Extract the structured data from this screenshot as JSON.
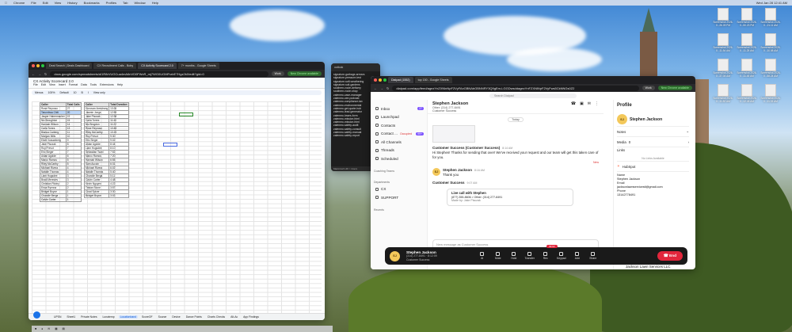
{
  "menubar": {
    "items": [
      "Chrome",
      "File",
      "Edit",
      "View",
      "History",
      "Bookmarks",
      "Profiles",
      "Tab",
      "Window",
      "Help"
    ],
    "clock": "Wed Jan 28 12:41 AM"
  },
  "sheets_window": {
    "tabs": [
      "Deal Search | Deals Dashboard",
      "CX Recruitment Calls - Boby",
      "CX Activity Scorecard 2.0",
      "7+ months - Google Sheets"
    ],
    "url": "docs.google.com/spreadsheets/d/1R8rVUGCua4mA6nVD0FWcR_mj7WG0UGMFrzbE7Hgz2k0/edit?gid=0",
    "work_label": "Work",
    "new_chrome": "New Chrome available",
    "doc_title": "CX Activity Scorecard 2.0",
    "menu": [
      "File",
      "Edit",
      "View",
      "Insert",
      "Format",
      "Data",
      "Tools",
      "Extensions",
      "Help"
    ],
    "toolbar": [
      "Menus",
      "100%",
      "Default",
      "10",
      "B",
      "I",
      "View only"
    ],
    "table1_headers": [
      "Caller",
      "Total Calls"
    ],
    "table1_rows": [
      [
        "Rose Reynoso",
        "27"
      ],
      [
        "Tarumbwa Chiti",
        "20"
      ],
      [
        "Jasper Habermacher",
        "19"
      ],
      [
        "Nic Broughton",
        "15"
      ],
      [
        "Hannah Wilson",
        "14"
      ],
      [
        "Carla Torres",
        "13"
      ],
      [
        "Bianca Carberg",
        "11"
      ],
      [
        "Morgan Mills",
        "10"
      ],
      [
        "Eliott Vossanberg",
        "9"
      ],
      [
        "Jake Pisczak",
        "8"
      ],
      [
        "Roy Prevot",
        "7"
      ],
      [
        "Eric Sleger",
        "7"
      ],
      [
        "Aidan Agolde",
        "6"
      ],
      [
        "Marco Ramos",
        "5"
      ],
      [
        "Riley McCarthy",
        "5"
      ],
      [
        "Michael Rivera",
        "4"
      ],
      [
        "Natalie Thomas",
        "4"
      ],
      [
        "Liam Hogsdee",
        "3"
      ],
      [
        "Bradi Meresiev",
        "3"
      ],
      [
        "Christian Fitzley",
        "2"
      ],
      [
        "Erica Ryenna",
        "2"
      ],
      [
        "Bridget Boyce",
        "1"
      ],
      [
        "Chandie Berga",
        "1"
      ],
      [
        "Calvin Carter",
        "1"
      ]
    ],
    "table2_headers": [
      "Caller",
      "Total Duration"
    ],
    "table2_rows": [
      [
        "Donovan Armstrong",
        "13:26"
      ],
      [
        "Jasmin Jongs",
        "12:55"
      ],
      [
        "Jake Pisczak",
        "12:38"
      ],
      [
        "Carla Torres",
        "11:40"
      ],
      [
        "Nic Brogdon",
        "11:22"
      ],
      [
        "Rose Reynoso",
        "10:48"
      ],
      [
        "Riley McCarthy",
        "10:15"
      ],
      [
        "Roy Prevot",
        "9:30"
      ],
      [
        "Eric Sleger",
        "9:02"
      ],
      [
        "Aidan Agolde",
        "8:44"
      ],
      [
        "Liam Hogsdee",
        "8:10"
      ],
      [
        "Sebastian Tsani",
        "7:52"
      ],
      [
        "Marco Ramos",
        "7:20"
      ],
      [
        "Hannah Wilson",
        "6:55"
      ],
      [
        "Sam Aucoin",
        "6:31"
      ],
      [
        "Michael Rivera",
        "6:02"
      ],
      [
        "Natalie Thomas",
        "5:40"
      ],
      [
        "Chandie Berga",
        "5:11"
      ],
      [
        "Calvin Carter",
        "4:48"
      ],
      [
        "Kevin Nguyen",
        "4:22"
      ],
      [
        "Tristan Stone",
        "3:57"
      ],
      [
        "Chad Spicer",
        "3:30"
      ],
      [
        "Bridget Boyce",
        "3:02"
      ]
    ],
    "sheet_tabs": [
      "UPSN",
      "Sheet1",
      "Private Notes",
      "Lunatemp",
      "Locationband",
      "ScoreOF",
      "Source",
      "Device",
      "Dance Points",
      "Charts Checks",
      "Alt-Ac",
      "App Findings"
    ]
  },
  "notes_window": {
    "title": "outlook",
    "url": "Macintosh HD > Users",
    "files": [
      "signature-garbage-arrears",
      "signature-pressure-test",
      "signature-soft-weathering",
      "signature-suit-gardens",
      "southern-route-delivery",
      "southern-route-shop",
      "zalenmo-case-manager",
      "zalenmo-cee-podcast",
      "zalenmo-compliance-tax",
      "zalenmo-environmental",
      "zalenmo-get-quote-hub",
      "zalenmo-lead-generator",
      "zalenmo-lowes-form",
      "zalenmo-mission.html",
      "zalenmo-mission.html",
      "zalenmo-safety-audit",
      "zalenmo-safety-consult",
      "zalenmo-safety-manual",
      "zalenmo-safety-report"
    ]
  },
  "dialpad_window": {
    "tabs": [
      "Dialpad (1552)",
      "top 150 - Google Sheets"
    ],
    "url": "dialpad.com/app/feed/agezYnZXNlnNpF2VyFAxGBNAbGBNNRY3Q9gEm-LGGDwsddagezYnFZXNlNpF2VyFws5CkNNGs0Z2",
    "work_label": "Work",
    "new_chrome": "New Chrome available",
    "search_placeholder": "Search Dialpad",
    "nav": [
      {
        "label": "Inbox",
        "badge": "27"
      },
      {
        "label": "Launchpad"
      },
      {
        "label": "Contacts"
      },
      {
        "label": "Contact ...",
        "status": "Occupied",
        "badge": "99+"
      },
      {
        "label": "All Channels"
      },
      {
        "label": "Threads"
      },
      {
        "label": "Scheduled"
      }
    ],
    "coaching_label": "Coaching Teams",
    "departments_label": "Departments",
    "departments": [
      "CX",
      "SUPPORT"
    ],
    "recents_label": "Recents",
    "contact": {
      "name": "Stephen Jackson",
      "phone": "Other: (314) 277-8491",
      "team": "Customer Success",
      "initials": "SJ"
    },
    "today_label": "Today",
    "messages": [
      {
        "from": "Customer Success (Customer Success)",
        "time": "8:14 AM",
        "text": "Hi Stephen! Thanks for sending that over! We've received your request and our team will get this taken care of for you.",
        "tag": "New"
      },
      {
        "from": "Stephen Jackson",
        "time": "8:16 AM",
        "text": "Thank you"
      },
      {
        "from": "Customer Success",
        "time": "9:07 AM",
        "text": ""
      }
    ],
    "live_call": {
      "title": "Live call with Stephen",
      "detail": "(877) 355-8606 > Other: (314) 277-8491",
      "made_by": "Made by: Jake Pisczak"
    },
    "compose_placeholder": "New message as Customer Success",
    "profile": {
      "title": "Profile",
      "name": "Stephen Jackson",
      "sections": [
        "Notes",
        "Media",
        "Links",
        "HubSpot"
      ],
      "media_count": "0",
      "no_links": "No Links Available",
      "hubspot_fields": [
        {
          "label": "Name",
          "value": "Stephen Jackson"
        },
        {
          "label": "Email",
          "value": "jacksonlawnservicestl@gmail.com"
        },
        {
          "label": "Phone",
          "value": "13142778491"
        }
      ],
      "company": "Jackson Lawn Services LLC"
    },
    "call": {
      "name": "Stephen Jackson",
      "phone": "(314) 277-8491 · 8:12:09",
      "team": "Customer Success",
      "timer": "09:02",
      "buttons": [
        "AI",
        "Mute",
        "Hold",
        "Transfer",
        "Rec",
        "Keypad",
        "Add",
        "Share"
      ],
      "end_label": "End"
    }
  },
  "desktop_icons": [
    "Screenshot 2026-0...26.09 PM",
    "Screenshot 2026-0...50.23 PM",
    "Screenshot 2026-0...21.11 AM",
    "Screenshot 2026-0...11.54 AM",
    "Screenshot 2026-0...11.25 AM",
    "Screenshot 2026-0...10.58 AM",
    "Screenshot 2026-0...37.04 AM",
    "Screenshot 2026-0...11.45 AM",
    "Screenshot 2026-0...58.24 AM",
    "Screenshot 2026-0...11.52 AM",
    "Screenshot 2026-0...12.45 AM",
    "Screenshot 2026-0...11.33 AM"
  ]
}
